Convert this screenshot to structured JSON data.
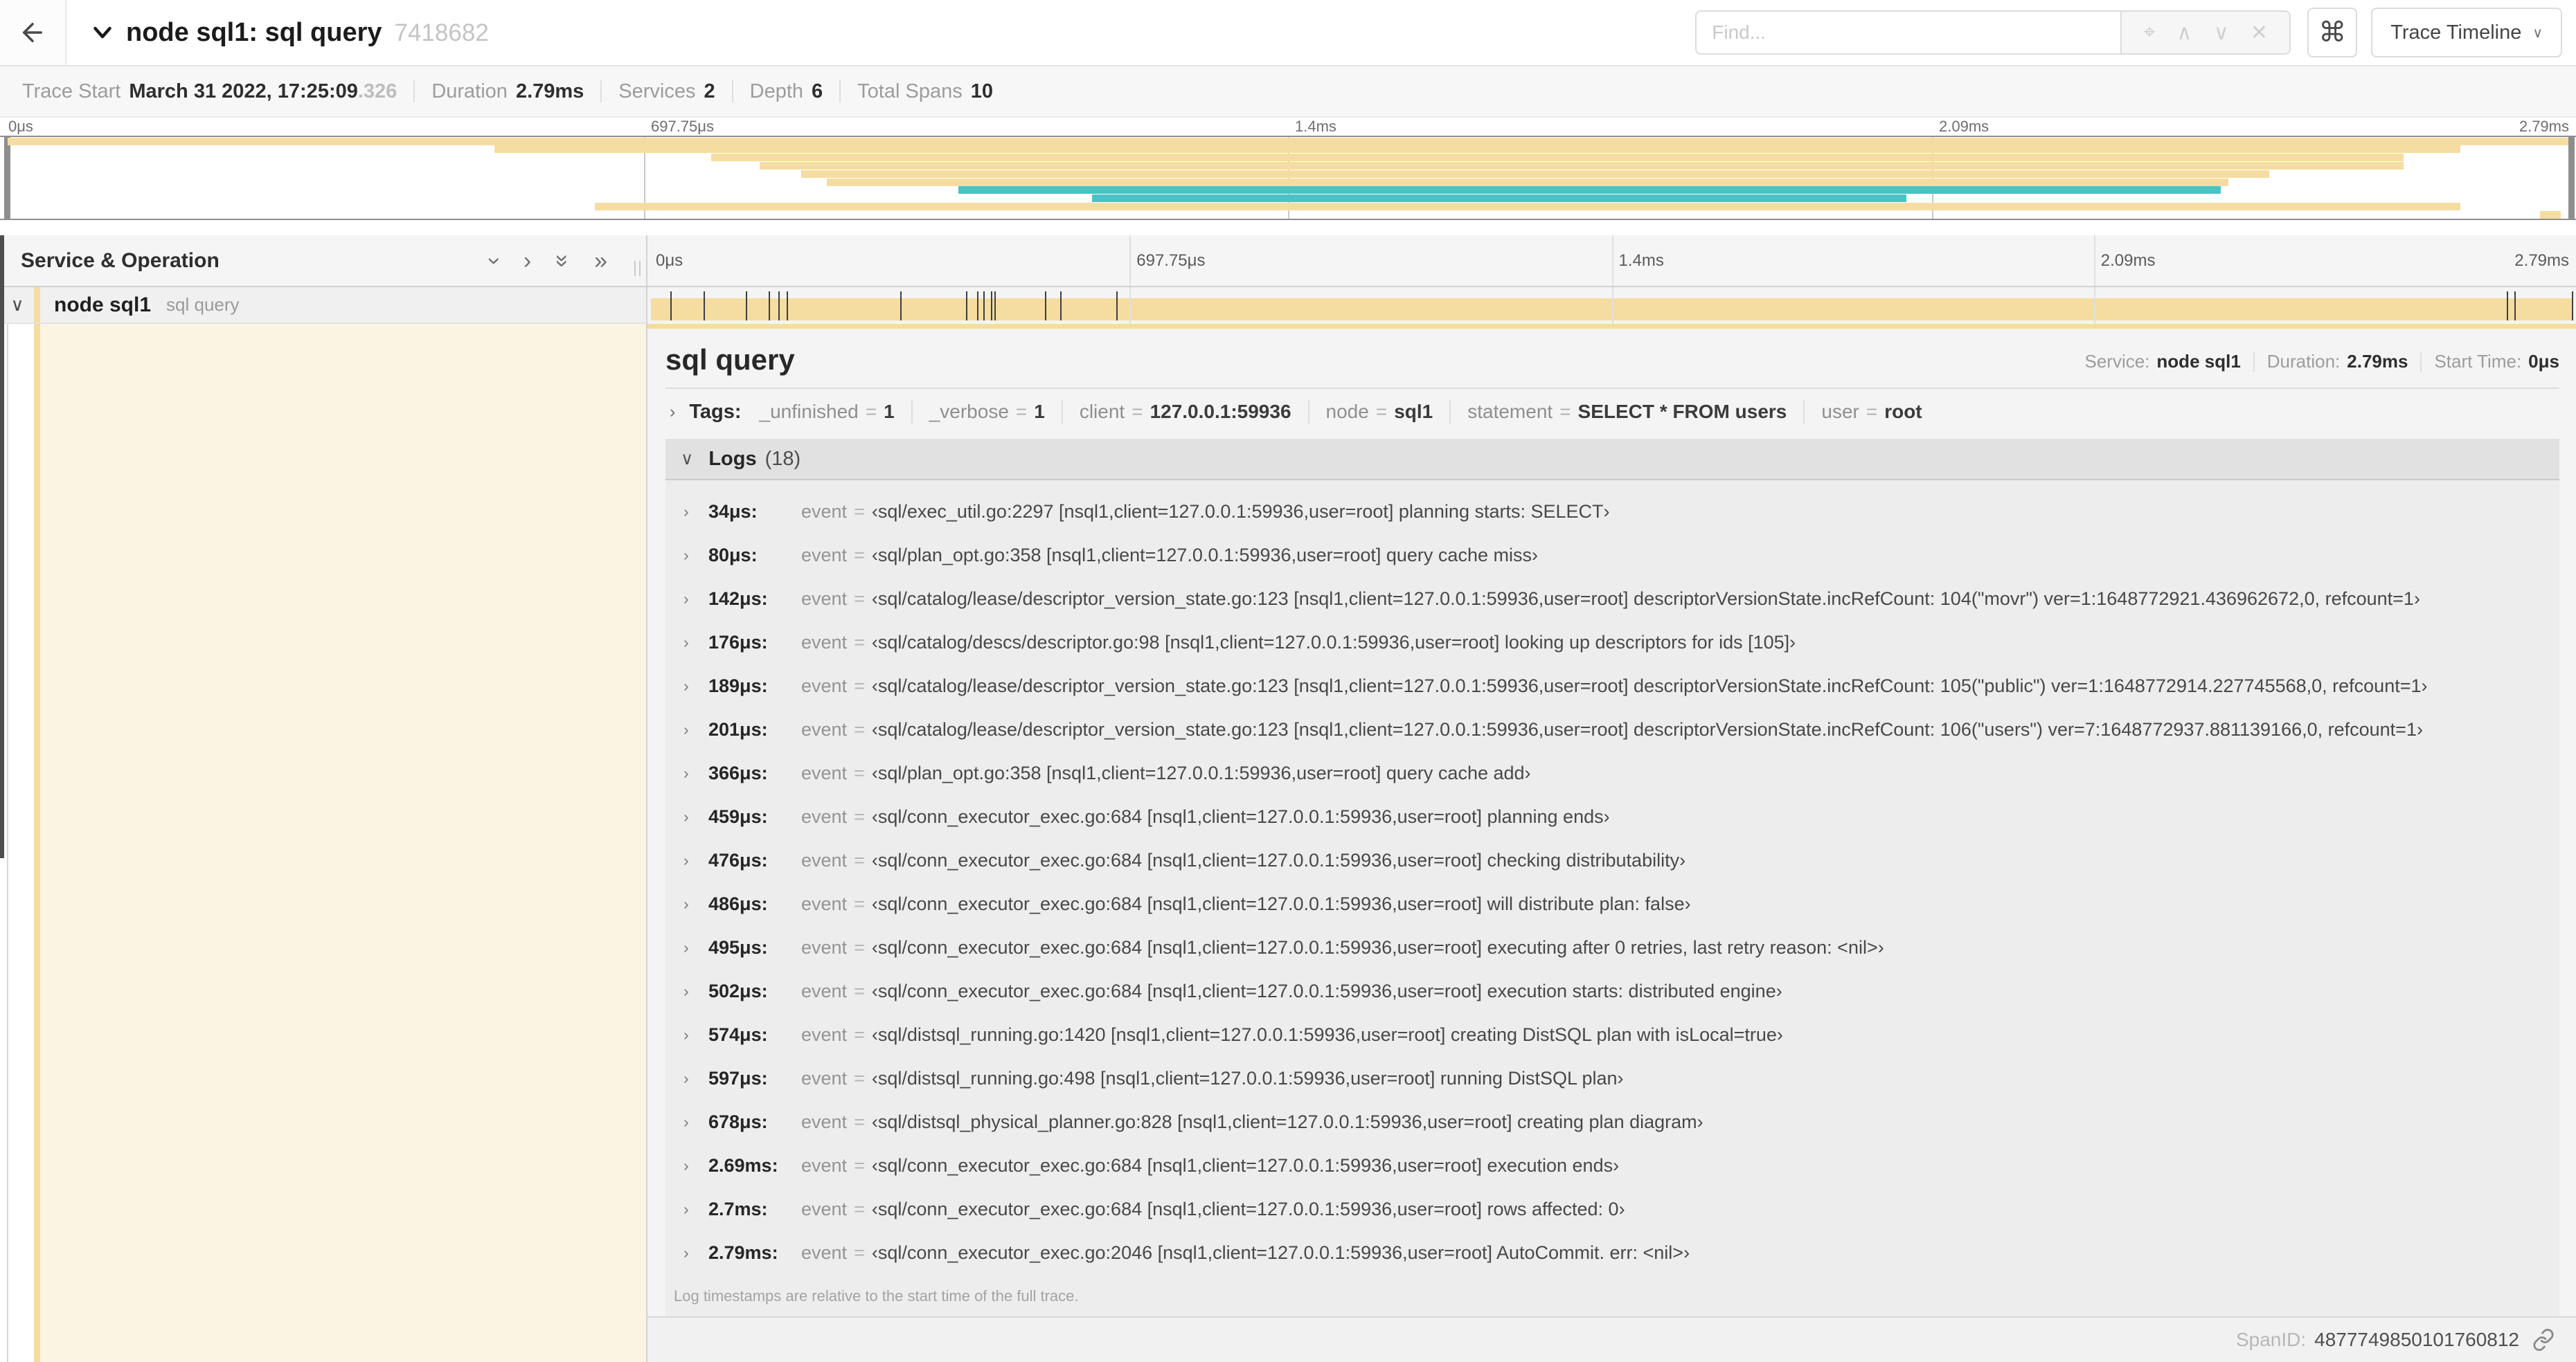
{
  "titlebar": {
    "title": "node sql1: sql query",
    "trace_id": "7418682",
    "find_placeholder": "Find...",
    "shortcut_key": "⌘",
    "view_selector": "Trace Timeline",
    "dropdown_glyph": "∨",
    "find_icons": [
      {
        "name": "locate",
        "glyph": "⌖"
      },
      {
        "name": "previous-result",
        "glyph": "∧"
      },
      {
        "name": "next-result",
        "glyph": "∨"
      },
      {
        "name": "clear-search",
        "glyph": "✕"
      }
    ]
  },
  "trace_meta": {
    "items": [
      {
        "label": "Trace Start",
        "value": "March 31 2022, 17:25:09",
        "suffix": ".326"
      },
      {
        "label": "Duration",
        "value": "2.79ms"
      },
      {
        "label": "Services",
        "value": "2"
      },
      {
        "label": "Depth",
        "value": "6"
      },
      {
        "label": "Total Spans",
        "value": "10"
      }
    ]
  },
  "timeline": {
    "ticks": [
      "0μs",
      "697.75μs",
      "1.4ms",
      "2.09ms",
      "2.79ms"
    ],
    "colors": {
      "tan": "#f5dda1",
      "teal": "#45c5c5",
      "cream": "#fcf4e3"
    },
    "minimap_spans": [
      {
        "left": 0.3,
        "width": 99.4,
        "color": "tan"
      },
      {
        "left": 19.2,
        "width": 76.3,
        "color": "tan"
      },
      {
        "left": 27.6,
        "width": 65.7,
        "color": "tan"
      },
      {
        "left": 29.5,
        "width": 63.8,
        "color": "tan"
      },
      {
        "left": 31.1,
        "width": 57.0,
        "color": "tan"
      },
      {
        "left": 32.1,
        "width": 54.4,
        "color": "tan"
      },
      {
        "left": 37.2,
        "width": 49.0,
        "color": "teal"
      },
      {
        "left": 42.4,
        "width": 31.6,
        "color": "teal"
      },
      {
        "left": 23.1,
        "width": 72.4,
        "color": "tan"
      },
      {
        "left": 98.6,
        "width": 0.8,
        "color": "tan"
      }
    ],
    "log_marker_pcts": [
      1.2,
      2.9,
      5.1,
      6.3,
      6.8,
      7.2,
      13.1,
      16.5,
      17.1,
      17.4,
      17.8,
      18.0,
      20.6,
      21.4,
      24.3,
      96.4,
      96.8,
      99.8
    ]
  },
  "span_table": {
    "header": "Service & Operation",
    "expander_icons": [
      {
        "name": "collapse-one-level",
        "glyph": "›",
        "rotate": true
      },
      {
        "name": "expand-one-level",
        "glyph": "›",
        "rotate": false
      },
      {
        "name": "collapse-all",
        "glyph": "»",
        "rotate": true
      },
      {
        "name": "expand-all",
        "glyph": "»",
        "rotate": false
      }
    ],
    "row": {
      "collapse_glyph": "∨",
      "service": "node sql1",
      "operation": "sql query"
    }
  },
  "detail": {
    "title": "sql query",
    "meta": [
      {
        "label": "Service:",
        "value": "node sql1"
      },
      {
        "label": "Duration:",
        "value": "2.79ms"
      },
      {
        "label": "Start Time:",
        "value": "0μs"
      }
    ],
    "tags_label": "Tags:",
    "tags": [
      {
        "key": "_unfinished",
        "value": "1"
      },
      {
        "key": "_verbose",
        "value": "1"
      },
      {
        "key": "client",
        "value": "127.0.0.1:59936"
      },
      {
        "key": "node",
        "value": "sql1"
      },
      {
        "key": "statement",
        "value": "SELECT * FROM users"
      },
      {
        "key": "user",
        "value": "root"
      }
    ],
    "logs_label": "Logs",
    "logs_count": "(18)",
    "logs": [
      {
        "time": "34μs:",
        "field": "event",
        "value": "‹sql/exec_util.go:2297 [nsql1,client=127.0.0.1:59936,user=root] planning starts: SELECT›"
      },
      {
        "time": "80μs:",
        "field": "event",
        "value": "‹sql/plan_opt.go:358 [nsql1,client=127.0.0.1:59936,user=root] query cache miss›"
      },
      {
        "time": "142μs:",
        "field": "event",
        "value": "‹sql/catalog/lease/descriptor_version_state.go:123 [nsql1,client=127.0.0.1:59936,user=root] descriptorVersionState.incRefCount: 104(\"movr\") ver=1:1648772921.436962672,0, refcount=1›"
      },
      {
        "time": "176μs:",
        "field": "event",
        "value": "‹sql/catalog/descs/descriptor.go:98 [nsql1,client=127.0.0.1:59936,user=root] looking up descriptors for ids [105]›"
      },
      {
        "time": "189μs:",
        "field": "event",
        "value": "‹sql/catalog/lease/descriptor_version_state.go:123 [nsql1,client=127.0.0.1:59936,user=root] descriptorVersionState.incRefCount: 105(\"public\") ver=1:1648772914.227745568,0, refcount=1›"
      },
      {
        "time": "201μs:",
        "field": "event",
        "value": "‹sql/catalog/lease/descriptor_version_state.go:123 [nsql1,client=127.0.0.1:59936,user=root] descriptorVersionState.incRefCount: 106(\"users\") ver=7:1648772937.881139166,0, refcount=1›"
      },
      {
        "time": "366μs:",
        "field": "event",
        "value": "‹sql/plan_opt.go:358 [nsql1,client=127.0.0.1:59936,user=root] query cache add›"
      },
      {
        "time": "459μs:",
        "field": "event",
        "value": "‹sql/conn_executor_exec.go:684 [nsql1,client=127.0.0.1:59936,user=root] planning ends›"
      },
      {
        "time": "476μs:",
        "field": "event",
        "value": "‹sql/conn_executor_exec.go:684 [nsql1,client=127.0.0.1:59936,user=root] checking distributability›"
      },
      {
        "time": "486μs:",
        "field": "event",
        "value": "‹sql/conn_executor_exec.go:684 [nsql1,client=127.0.0.1:59936,user=root] will distribute plan: false›"
      },
      {
        "time": "495μs:",
        "field": "event",
        "value": "‹sql/conn_executor_exec.go:684 [nsql1,client=127.0.0.1:59936,user=root] executing after 0 retries, last retry reason: <nil>›"
      },
      {
        "time": "502μs:",
        "field": "event",
        "value": "‹sql/conn_executor_exec.go:684 [nsql1,client=127.0.0.1:59936,user=root] execution starts: distributed engine›"
      },
      {
        "time": "574μs:",
        "field": "event",
        "value": "‹sql/distsql_running.go:1420 [nsql1,client=127.0.0.1:59936,user=root] creating DistSQL plan with isLocal=true›"
      },
      {
        "time": "597μs:",
        "field": "event",
        "value": "‹sql/distsql_running.go:498 [nsql1,client=127.0.0.1:59936,user=root] running DistSQL plan›"
      },
      {
        "time": "678μs:",
        "field": "event",
        "value": "‹sql/distsql_physical_planner.go:828 [nsql1,client=127.0.0.1:59936,user=root] creating plan diagram›"
      },
      {
        "time": "2.69ms:",
        "field": "event",
        "value": "‹sql/conn_executor_exec.go:684 [nsql1,client=127.0.0.1:59936,user=root] execution ends›"
      },
      {
        "time": "2.7ms:",
        "field": "event",
        "value": "‹sql/conn_executor_exec.go:684 [nsql1,client=127.0.0.1:59936,user=root] rows affected: 0›"
      },
      {
        "time": "2.79ms:",
        "field": "event",
        "value": "‹sql/conn_executor_exec.go:2046 [nsql1,client=127.0.0.1:59936,user=root] AutoCommit. err: <nil>›"
      }
    ],
    "logs_footnote": "Log timestamps are relative to the start time of the full trace.",
    "span_id_label": "SpanID:",
    "span_id": "4877749850101760812"
  }
}
